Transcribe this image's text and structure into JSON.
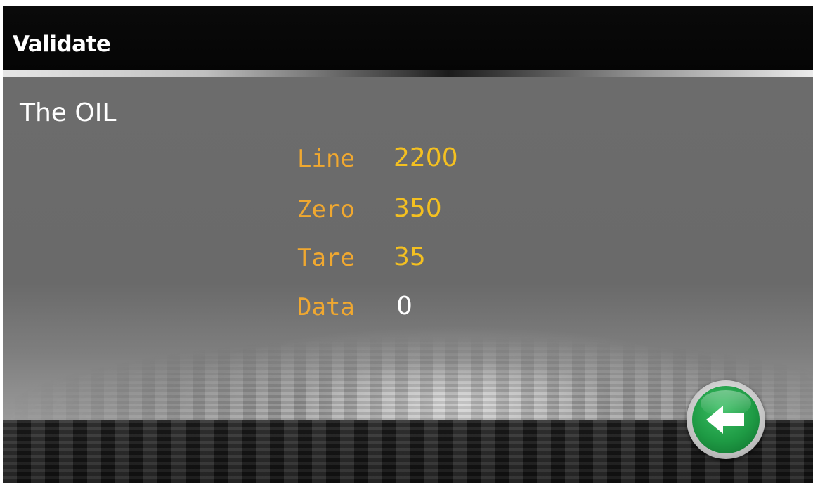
{
  "window": {
    "title": "Validate"
  },
  "main": {
    "subtitle": "The OIL",
    "fields": [
      {
        "label": "Line",
        "value": "2200"
      },
      {
        "label": "Zero",
        "value": "350"
      },
      {
        "label": "Tare",
        "value": "35"
      },
      {
        "label": "Data",
        "value": "0"
      }
    ]
  },
  "footer": {
    "back_icon": "arrow-left-icon"
  },
  "colors": {
    "label": "#f0a830",
    "value": "#f4c020",
    "back_button": "#1e9a44"
  }
}
